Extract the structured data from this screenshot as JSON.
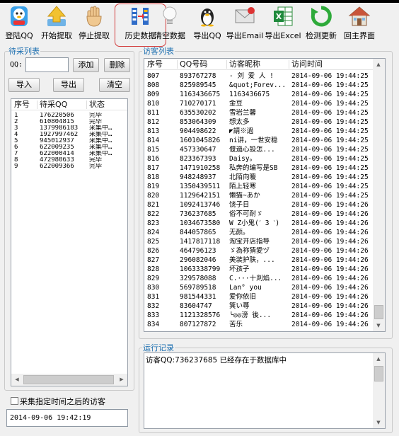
{
  "toolbar": [
    {
      "label": "登陆QQ",
      "icon": "qq-penguin-icon"
    },
    {
      "label": "开始提取",
      "icon": "arrow-up-icon"
    },
    {
      "label": "停止提取",
      "icon": "hand-stop-icon"
    },
    {
      "label": "历史数据",
      "icon": "history-columns-icon"
    },
    {
      "label": "清空数据",
      "icon": "lightbulb-icon"
    },
    {
      "label": "导出QQ",
      "icon": "penguin-export-icon"
    },
    {
      "label": "导出Email",
      "icon": "email-icon"
    },
    {
      "label": "导出Excel",
      "icon": "excel-icon"
    },
    {
      "label": "检测更新",
      "icon": "refresh-icon"
    },
    {
      "label": "回主界面",
      "icon": "home-icon"
    }
  ],
  "pending": {
    "legend": "待采列表",
    "qq_label": "QQ:",
    "qq_value": "",
    "add": "添加",
    "del": "删除",
    "import": "导入",
    "export": "导出",
    "clear": "清空",
    "columns": [
      "序号",
      "待采QQ",
      "状态"
    ],
    "rows": [
      [
        "1",
        "176220506",
        "完毕"
      ],
      [
        "2",
        "610804815",
        "完毕"
      ],
      [
        "3",
        "1379986183",
        "采集中…"
      ],
      [
        "4",
        "1927997462",
        "采集中…"
      ],
      [
        "5",
        "945012937",
        "采集中…"
      ],
      [
        "6",
        "622009235",
        "采集中…"
      ],
      [
        "7",
        "622000414",
        "采集中…"
      ],
      [
        "8",
        "472980633",
        "完毕"
      ],
      [
        "9",
        "622009366",
        "完毕"
      ]
    ]
  },
  "since": {
    "label": "采集指定时间之后的访客",
    "checked": false,
    "time": "2014-09-06 19:42:19"
  },
  "visitors": {
    "legend": "访客列表",
    "columns": [
      "序号",
      "QQ号码",
      "访客昵称",
      "访问时间"
    ],
    "rows": [
      [
        "807",
        "893767278",
        "- 刘 爱 人 !",
        "2014-09-06 19:44:25"
      ],
      [
        "808",
        "825989545",
        "&quot;Forev...",
        "2014-09-06 19:44:25"
      ],
      [
        "809",
        "1163436675",
        "1163436675",
        "2014-09-06 19:44:25"
      ],
      [
        "810",
        "710270171",
        "金豆",
        "2014-09-06 19:44:25"
      ],
      [
        "811",
        "635530202",
        "雪岩兰馨",
        "2014-09-06 19:44:25"
      ],
      [
        "812",
        "853064309",
        "想太多",
        "2014-09-06 19:44:25"
      ],
      [
        "813",
        "904498622",
        "◤請※過",
        "2014-09-06 19:44:25"
      ],
      [
        "814",
        "1601045826",
        "ni讲，一世安稳",
        "2014-09-06 19:44:25"
      ],
      [
        "815",
        "457330647",
        "偃過心設怎...",
        "2014-09-06 19:44:25"
      ],
      [
        "816",
        "823367393",
        "Daisy。",
        "2014-09-06 19:44:25"
      ],
      [
        "817",
        "1471910258",
        "私奔的编写是SB",
        "2014-09-06 19:44:25"
      ],
      [
        "818",
        "948248937",
        "北陌向暖",
        "2014-09-06 19:44:25"
      ],
      [
        "819",
        "1350439511",
        "陌上轻寒",
        "2014-09-06 19:44:25"
      ],
      [
        "820",
        "1129642151",
        "懒猫~あか",
        "2014-09-06 19:44:25"
      ],
      [
        "821",
        "1092413746",
        "饶子日",
        "2014-09-06 19:44:26"
      ],
      [
        "822",
        "736237685",
        "俗不可耐ゞ",
        "2014-09-06 19:44:26"
      ],
      [
        "823",
        "1034673580",
        "W Z小鬼(ˊ 3 ˋ)",
        "2014-09-06 19:44:26"
      ],
      [
        "824",
        "844057865",
        "无颜。",
        "2014-09-06 19:44:26"
      ],
      [
        "825",
        "1417817118",
        "淘宝开店指导",
        "2014-09-06 19:44:26"
      ],
      [
        "826",
        "464796123",
        "ゞ為祢猜愛ヅ",
        "2014-09-06 19:44:26"
      ],
      [
        "827",
        "296082046",
        "美装护肤，...",
        "2014-09-06 19:44:26"
      ],
      [
        "828",
        "1063338799",
        "坏孩子",
        "2014-09-06 19:44:26"
      ],
      [
        "829",
        "329578088",
        "C.···十剡焰...",
        "2014-09-06 19:44:26"
      ],
      [
        "830",
        "569789518",
        "Lan° you",
        "2014-09-06 19:44:26"
      ],
      [
        "831",
        "981544331",
        "爱你依旧",
        "2014-09-06 19:44:26"
      ],
      [
        "832",
        "83604747",
        "箕い蕁",
        "2014-09-06 19:44:26"
      ],
      [
        "833",
        "1121328576",
        "╰◎◎滂 後...",
        "2014-09-06 19:44:26"
      ],
      [
        "834",
        "807127872",
        "苦乐",
        "2014-09-06 19:44:26"
      ]
    ]
  },
  "log": {
    "legend": "运行记录",
    "text": "访客QQ:736237685 已经存在于数据库中"
  }
}
